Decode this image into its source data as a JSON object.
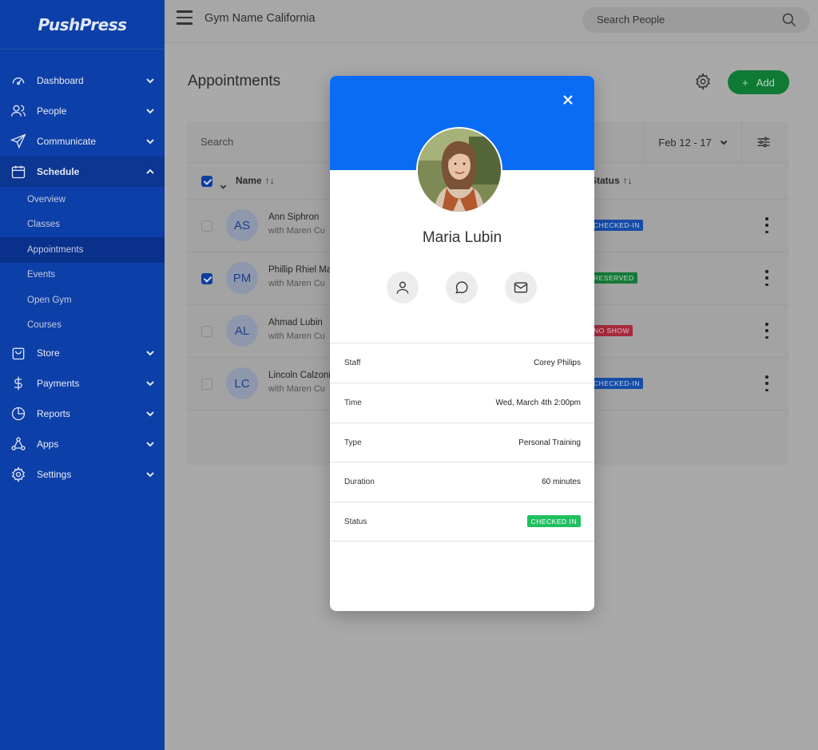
{
  "brand": {
    "logo_text": "PushPress"
  },
  "sidebar": {
    "items": [
      {
        "label": "Dashboard",
        "icon": "dashboard-icon"
      },
      {
        "label": "People",
        "icon": "people-icon"
      },
      {
        "label": "Communicate",
        "icon": "send-icon"
      },
      {
        "label": "Schedule",
        "icon": "calendar-icon"
      },
      {
        "label": "Store",
        "icon": "store-icon"
      },
      {
        "label": "Payments",
        "icon": "dollar-icon"
      },
      {
        "label": "Reports",
        "icon": "pie-chart-icon"
      },
      {
        "label": "Apps",
        "icon": "apps-icon"
      },
      {
        "label": "Settings",
        "icon": "gear-icon"
      }
    ],
    "schedule_sub": [
      "Overview",
      "Classes",
      "Appointments",
      "Events",
      "Open Gym",
      "Courses"
    ],
    "active_sub": "Appointments"
  },
  "topbar": {
    "gym_name": "Gym Name California",
    "search_placeholder": "Search People"
  },
  "main": {
    "title": "Appointments",
    "add_label": "Add",
    "table_search": "Search",
    "date_range": "Feb 12 - 17",
    "columns": {
      "name": "Name",
      "status": "Status"
    },
    "rows": [
      {
        "initials": "AS",
        "name": "Ann Siphron",
        "sub": "with Maren Cu",
        "status": "CHECKED-IN",
        "checked": false
      },
      {
        "initials": "PM",
        "name": "Phillip Rhiel Ma",
        "sub": "with Maren Cu",
        "status": "RESERVED",
        "checked": true
      },
      {
        "initials": "AL",
        "name": "Ahmad Lubin",
        "sub": "with Maren Cu",
        "status": "NO SHOW",
        "checked": false
      },
      {
        "initials": "LC",
        "name": "Lincoln Calzoni",
        "sub": "with Maren Cu",
        "status": "CHECKED-IN",
        "checked": false
      }
    ]
  },
  "modal": {
    "name": "Maria Lubin",
    "details": [
      {
        "key": "Staff",
        "value": "Corey Philips"
      },
      {
        "key": "Time",
        "value": "Wed, March 4th 2:00pm"
      },
      {
        "key": "Type",
        "value": "Personal Training"
      },
      {
        "key": "Duration",
        "value": "60 minutes"
      },
      {
        "key": "Status",
        "value": "CHECKED IN"
      }
    ]
  },
  "colors": {
    "sidebar": "#0d3fa8",
    "modal_header": "#0a6cf5",
    "add_button": "#0f7a34",
    "checked_in": "#20c060"
  }
}
